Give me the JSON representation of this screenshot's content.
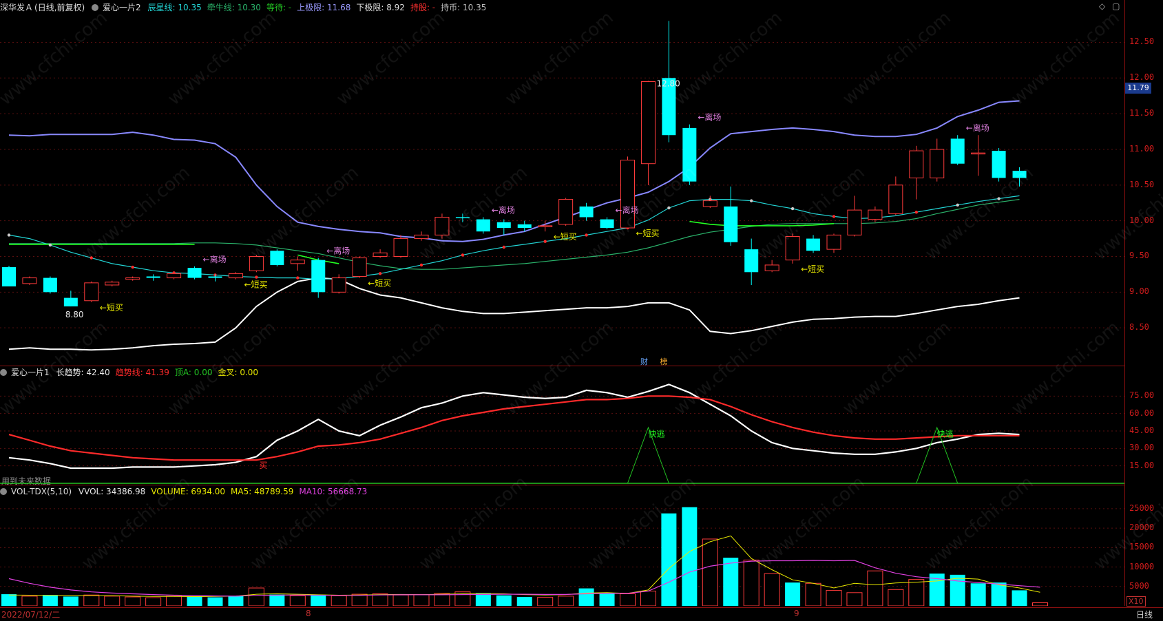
{
  "main_header": {
    "stock": "深华发Ａ",
    "mode": "(日线,前复权)",
    "indicator": "爱心一片2",
    "items": [
      {
        "label": "辰星线:",
        "value": "10.35",
        "color": "#22d4d4"
      },
      {
        "label": "牵牛线:",
        "value": "10.30",
        "color": "#2ab26a"
      },
      {
        "label": "等待:",
        "value": "-",
        "color": "#22c322"
      },
      {
        "label": "上极限:",
        "value": "11.68",
        "color": "#9a9aff"
      },
      {
        "label": "下极限:",
        "value": "8.92",
        "color": "#e0e0e0"
      },
      {
        "label": "持股:",
        "value": "-",
        "color": "#ff3030"
      },
      {
        "label": "持币:",
        "value": "10.35",
        "color": "#bbbbbb"
      }
    ]
  },
  "mid_header": {
    "indicator": "爱心一片1",
    "items": [
      {
        "label": "长趋势:",
        "value": "42.40",
        "color": "#e8e8e8"
      },
      {
        "label": "趋势线:",
        "value": "41.39",
        "color": "#ff2a2a"
      },
      {
        "label": "顶A:",
        "value": "0.00",
        "color": "#22c322"
      },
      {
        "label": "金叉:",
        "value": "0.00",
        "color": "#e8e800"
      }
    ]
  },
  "vol_header": {
    "indicator": "VOL-TDX(5,10)",
    "items": [
      {
        "label": "VVOL:",
        "value": "34386.98",
        "color": "#e8e8e8"
      },
      {
        "label": "VOLUME:",
        "value": "6934.00",
        "color": "#e8e800"
      },
      {
        "label": "MA5:",
        "value": "48789.59",
        "color": "#e8e800"
      },
      {
        "label": "MA10:",
        "value": "56668.73",
        "color": "#e040e0"
      }
    ]
  },
  "current_price_label": "11.79",
  "missing_data_note": "用到未来数据",
  "bottom": {
    "first_date": "2022/07/12/二",
    "month1": "8",
    "month2": "9",
    "period": "日线",
    "zoom": "X10"
  },
  "badges": [
    "财",
    "榜"
  ],
  "watermark": "www.cfchi.com",
  "colors": {
    "up": "#ff3b3b",
    "down": "#00ffff",
    "upper_band": "#8888ff",
    "lower_band": "#ffffff",
    "star_line": "#22d4d4",
    "ox_line": "#2ab26a",
    "wait_line": "#22ff22"
  },
  "chart_data": [
    {
      "type": "candlestick",
      "title": "",
      "ylim": [
        8.0,
        12.9
      ],
      "y_ticks": [
        "12.50",
        "12.00",
        "11.50",
        "11.00",
        "10.50",
        "10.00",
        "9.50",
        "9.00",
        "8.50"
      ],
      "candles": [
        [
          9.35,
          9.08,
          9.37,
          9.08
        ],
        [
          9.12,
          9.2,
          9.22,
          9.1
        ],
        [
          9.2,
          9.0,
          9.22,
          8.98
        ],
        [
          8.92,
          8.8,
          9.02,
          8.8
        ],
        [
          8.88,
          9.13,
          9.15,
          8.86
        ],
        [
          9.1,
          9.14,
          9.16,
          9.08
        ],
        [
          9.18,
          9.2,
          9.22,
          9.16
        ],
        [
          9.22,
          9.2,
          9.25,
          9.16
        ],
        [
          9.2,
          9.26,
          9.28,
          9.18
        ],
        [
          9.34,
          9.2,
          9.36,
          9.18
        ],
        [
          9.22,
          9.2,
          9.25,
          9.15
        ],
        [
          9.2,
          9.26,
          9.28,
          9.18
        ],
        [
          9.3,
          9.5,
          9.52,
          9.28
        ],
        [
          9.58,
          9.38,
          9.6,
          9.36
        ],
        [
          9.4,
          9.45,
          9.5,
          9.3
        ],
        [
          9.45,
          9.0,
          9.48,
          8.92
        ],
        [
          9.0,
          9.2,
          9.25,
          8.98
        ],
        [
          9.22,
          9.48,
          9.5,
          9.2
        ],
        [
          9.5,
          9.55,
          9.6,
          9.48
        ],
        [
          9.5,
          9.75,
          9.8,
          9.48
        ],
        [
          9.75,
          9.8,
          9.85,
          9.72
        ],
        [
          9.8,
          10.05,
          10.1,
          9.75
        ],
        [
          10.05,
          10.04,
          10.1,
          9.98
        ],
        [
          10.02,
          9.85,
          10.05,
          9.82
        ],
        [
          9.98,
          9.9,
          10.02,
          9.8
        ],
        [
          9.95,
          9.9,
          10.0,
          9.85
        ],
        [
          9.92,
          9.93,
          10.0,
          9.85
        ],
        [
          9.95,
          10.3,
          10.32,
          9.93
        ],
        [
          10.2,
          10.05,
          10.25,
          10.0
        ],
        [
          10.02,
          9.9,
          10.05,
          9.88
        ],
        [
          9.9,
          10.85,
          10.9,
          9.9
        ],
        [
          10.8,
          11.95,
          11.96,
          10.5
        ],
        [
          12.0,
          11.2,
          12.8,
          11.1
        ],
        [
          11.3,
          10.55,
          11.35,
          10.5
        ],
        [
          10.2,
          10.28,
          10.35,
          10.18
        ],
        [
          10.2,
          9.7,
          10.48,
          9.65
        ],
        [
          9.6,
          9.28,
          9.75,
          9.1
        ],
        [
          9.3,
          9.38,
          9.45,
          9.28
        ],
        [
          9.45,
          9.78,
          9.82,
          9.4
        ],
        [
          9.75,
          9.58,
          9.8,
          9.55
        ],
        [
          9.6,
          9.8,
          9.82,
          9.55
        ],
        [
          9.8,
          10.15,
          10.35,
          9.78
        ],
        [
          10.02,
          10.15,
          10.2,
          9.98
        ],
        [
          10.1,
          10.5,
          10.62,
          10.08
        ],
        [
          10.6,
          10.98,
          11.05,
          10.3
        ],
        [
          10.6,
          11.0,
          11.15,
          10.55
        ],
        [
          11.15,
          10.8,
          11.2,
          10.78
        ],
        [
          10.95,
          10.95,
          11.2,
          10.63
        ],
        [
          10.98,
          10.6,
          11.02,
          10.55
        ],
        [
          10.7,
          10.6,
          10.75,
          10.48
        ]
      ],
      "upper_band": [
        11.2,
        11.19,
        11.21,
        11.21,
        11.21,
        11.21,
        11.24,
        11.2,
        11.14,
        11.13,
        11.08,
        10.89,
        10.5,
        10.2,
        9.98,
        9.92,
        9.88,
        9.85,
        9.83,
        9.78,
        9.76,
        9.72,
        9.71,
        9.74,
        9.8,
        9.85,
        9.95,
        10.05,
        10.15,
        10.25,
        10.32,
        10.4,
        10.55,
        10.75,
        11.02,
        11.22,
        11.25,
        11.28,
        11.3,
        11.28,
        11.25,
        11.2,
        11.18,
        11.18,
        11.21,
        11.3,
        11.46,
        11.55,
        11.66,
        11.68
      ],
      "lower_band": [
        8.2,
        8.22,
        8.2,
        8.2,
        8.19,
        8.2,
        8.22,
        8.25,
        8.27,
        8.28,
        8.3,
        8.5,
        8.8,
        9.0,
        9.15,
        9.2,
        9.18,
        9.05,
        8.96,
        8.92,
        8.85,
        8.78,
        8.73,
        8.7,
        8.7,
        8.72,
        8.74,
        8.76,
        8.78,
        8.78,
        8.8,
        8.85,
        8.85,
        8.75,
        8.45,
        8.42,
        8.46,
        8.52,
        8.58,
        8.62,
        8.63,
        8.65,
        8.66,
        8.66,
        8.7,
        8.75,
        8.8,
        8.83,
        8.88,
        8.92
      ],
      "star_line": [
        9.8,
        9.75,
        9.66,
        9.56,
        9.48,
        9.4,
        9.35,
        9.3,
        9.27,
        9.26,
        9.24,
        9.22,
        9.21,
        9.2,
        9.2,
        9.18,
        9.19,
        9.22,
        9.26,
        9.32,
        9.38,
        9.44,
        9.52,
        9.58,
        9.63,
        9.67,
        9.71,
        9.75,
        9.8,
        9.85,
        9.9,
        10.01,
        10.18,
        10.28,
        10.3,
        10.3,
        10.28,
        10.22,
        10.17,
        10.1,
        10.06,
        10.03,
        10.04,
        10.07,
        10.12,
        10.17,
        10.22,
        10.27,
        10.31,
        10.35
      ],
      "ox_line": [
        9.68,
        9.68,
        9.68,
        9.68,
        9.68,
        9.68,
        9.68,
        9.68,
        9.68,
        9.69,
        9.69,
        9.68,
        9.66,
        9.62,
        9.58,
        9.54,
        9.48,
        9.42,
        9.37,
        9.33,
        9.32,
        9.32,
        9.34,
        9.36,
        9.38,
        9.4,
        9.43,
        9.46,
        9.49,
        9.52,
        9.56,
        9.62,
        9.7,
        9.78,
        9.84,
        9.88,
        9.92,
        9.95,
        9.96,
        9.96,
        9.96,
        9.96,
        9.97,
        9.99,
        10.03,
        10.1,
        10.16,
        10.22,
        10.26,
        10.3
      ],
      "wait_line_segments": [
        {
          "from": 0,
          "to": 9,
          "values": [
            9.67,
            9.67,
            9.67,
            9.67,
            9.67,
            9.67,
            9.67,
            9.67,
            9.67,
            9.67
          ]
        },
        {
          "from": 14,
          "to": 16,
          "values": [
            9.52,
            9.45,
            9.4
          ]
        },
        {
          "from": 33,
          "to": 40,
          "values": [
            9.99,
            9.95,
            9.93,
            9.93,
            9.93,
            9.93,
            9.94,
            9.96
          ]
        }
      ],
      "annotations": [
        {
          "i": 3,
          "text": "8.80",
          "anchor": "low",
          "color": "#e8e8e8"
        },
        {
          "i": 31,
          "text": "12.80",
          "anchor": "high",
          "color": "#e8e8e8"
        },
        {
          "i": 4,
          "text": "←短买",
          "color": "#e8e800"
        },
        {
          "i": 11,
          "text": "←短买",
          "color": "#e8e800"
        },
        {
          "i": 17,
          "text": "←短买",
          "color": "#e8e800"
        },
        {
          "i": 26,
          "text": "←短买",
          "color": "#e8e800"
        },
        {
          "i": 30,
          "text": "←短买",
          "color": "#e8e800"
        },
        {
          "i": 38,
          "text": "←短买",
          "color": "#e8e800"
        },
        {
          "i": 9,
          "text": "←离场",
          "color": "#e080e0"
        },
        {
          "i": 15,
          "text": "←离场",
          "color": "#e080e0"
        },
        {
          "i": 23,
          "text": "←离场",
          "color": "#e080e0"
        },
        {
          "i": 29,
          "text": "←离场",
          "color": "#e080e0"
        },
        {
          "i": 33,
          "text": "←离场",
          "color": "#e080e0"
        },
        {
          "i": 46,
          "text": "←离场",
          "color": "#e080e0"
        }
      ]
    },
    {
      "type": "line",
      "title": "",
      "ylim": [
        0,
        90
      ],
      "y_ticks": [
        "75.00",
        "60.00",
        "45.00",
        "30.00",
        "15.00"
      ],
      "series": [
        {
          "name": "长趋势",
          "color": "#ffffff",
          "values": [
            22,
            20,
            17,
            13,
            13,
            13,
            14,
            14,
            14,
            15,
            16,
            18,
            23,
            37,
            45,
            55,
            45,
            41,
            50,
            57,
            65,
            69,
            75,
            78,
            76,
            74,
            73,
            74,
            80,
            78,
            74,
            79,
            85,
            78,
            68,
            58,
            45,
            35,
            30,
            28,
            26,
            25,
            25,
            27,
            30,
            35,
            38,
            42,
            43,
            42
          ]
        },
        {
          "name": "趋势线",
          "color": "#ff2a2a",
          "values": [
            42,
            37,
            32,
            28,
            26,
            24,
            22,
            21,
            20,
            20,
            20,
            20,
            20,
            23,
            27,
            32,
            33,
            35,
            38,
            43,
            48,
            54,
            58,
            61,
            64,
            66,
            68,
            70,
            72,
            72,
            73,
            75,
            75,
            74,
            72,
            66,
            59,
            53,
            48,
            44,
            41,
            39,
            38,
            38,
            39,
            40,
            41,
            41,
            41,
            41
          ]
        }
      ],
      "escape_signals": [
        {
          "i": 31,
          "text": "快逃"
        },
        {
          "i": 45,
          "text": "快逃"
        }
      ],
      "buy_signal": {
        "i": 12,
        "text": "买"
      }
    },
    {
      "type": "bar",
      "title": "",
      "ylim": [
        0,
        28000
      ],
      "y_ticks": [
        "25000",
        "20000",
        "15000",
        "10000",
        "5000"
      ],
      "volumes": [
        3000,
        2500,
        2800,
        2400,
        2800,
        2500,
        2300,
        2100,
        2500,
        2400,
        2200,
        2500,
        4600,
        2900,
        2600,
        2800,
        2600,
        3000,
        3100,
        2800,
        2900,
        3200,
        3600,
        3300,
        2700,
        2300,
        2200,
        2500,
        4500,
        3100,
        3100,
        3800,
        23800,
        25400,
        17200,
        12400,
        11800,
        8300,
        6000,
        5800,
        4000,
        3400,
        9000,
        4200,
        6800,
        8300,
        8000,
        5800,
        6000,
        4000,
        800
      ],
      "volume_up": [
        false,
        true,
        false,
        false,
        true,
        true,
        true,
        true,
        true,
        false,
        false,
        false,
        true,
        false,
        true,
        false,
        true,
        true,
        true,
        true,
        true,
        true,
        true,
        false,
        false,
        false,
        true,
        true,
        false,
        false,
        true,
        true,
        false,
        false,
        true,
        false,
        true,
        true,
        false,
        true,
        true,
        true,
        true,
        true,
        true,
        false,
        false,
        false,
        false,
        false,
        true
      ],
      "ma5": [
        2800,
        2750,
        2700,
        2650,
        2600,
        2620,
        2500,
        2450,
        2420,
        2400,
        2450,
        2500,
        3000,
        3100,
        3000,
        2850,
        2750,
        2800,
        2900,
        2950,
        2900,
        3000,
        3100,
        3150,
        3100,
        2900,
        2800,
        2900,
        3300,
        3400,
        3200,
        4100,
        9600,
        14000,
        16500,
        18000,
        12200,
        9300,
        6700,
        5800,
        4600,
        5800,
        5400,
        5900,
        6100,
        6400,
        7100,
        6900,
        5400,
        4600,
        3500
      ],
      "ma10": [
        7000,
        5800,
        4800,
        4100,
        3600,
        3300,
        3100,
        2900,
        2750,
        2650,
        2550,
        2500,
        2700,
        2750,
        2800,
        2750,
        2700,
        2700,
        2800,
        2850,
        2850,
        2850,
        2900,
        2950,
        3000,
        3000,
        2950,
        2950,
        3100,
        3200,
        3200,
        3800,
        6100,
        8700,
        10200,
        11000,
        11500,
        11600,
        11600,
        11700,
        11600,
        11700,
        9800,
        8400,
        7500,
        7000,
        6400,
        6000,
        5600,
        5200,
        4800
      ]
    }
  ]
}
